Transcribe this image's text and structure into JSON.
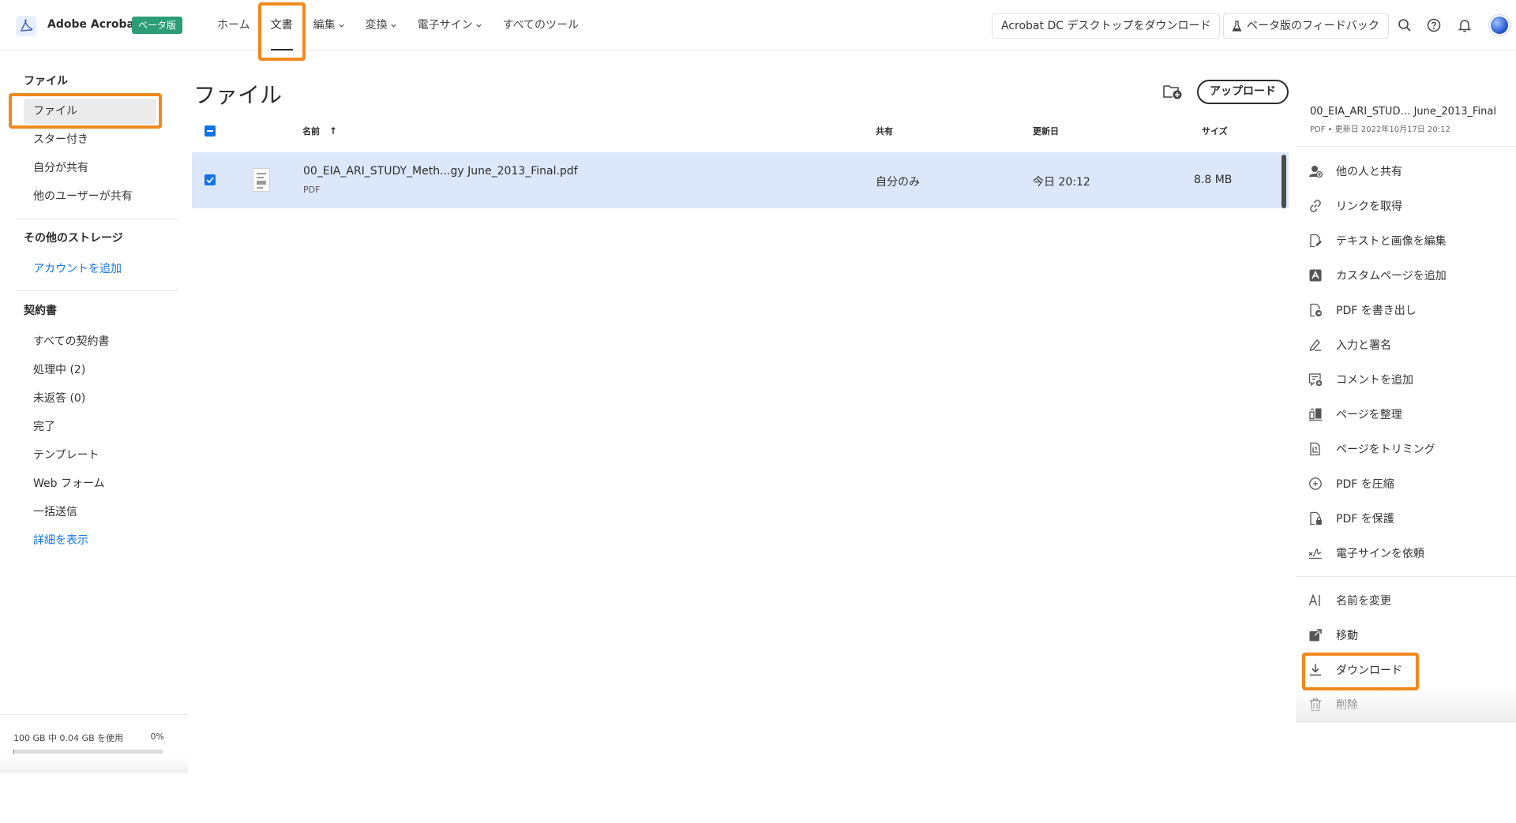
{
  "header": {
    "app_title": "Adobe Acrobat",
    "beta_badge": "ベータ版",
    "nav": {
      "home": "ホーム",
      "documents": "文書",
      "edit": "編集",
      "convert": "変換",
      "esign": "電子サイン",
      "all_tools": "すべてのツール"
    },
    "download_desktop": "Acrobat DC デスクトップをダウンロード",
    "beta_feedback": "ベータ版のフィードバック",
    "icons": [
      "search-icon",
      "help-icon",
      "bell-icon",
      "avatar"
    ]
  },
  "sidebar": {
    "files_heading": "ファイル",
    "files_items": {
      "files": "ファイル",
      "starred": "スター付き",
      "shared_by_me": "自分が共有",
      "shared_by_others": "他のユーザーが共有"
    },
    "other_storage_heading": "その他のストレージ",
    "add_account": "アカウントを追加",
    "agreements_heading": "契約書",
    "agreements_items": {
      "all": "すべての契約書",
      "in_progress": "処理中 (2)",
      "waiting": "未返答 (0)",
      "completed": "完了",
      "templates": "テンプレート",
      "web_forms": "Web フォーム",
      "bulk_send": "一括送信",
      "show_more": "詳細を表示"
    },
    "storage": {
      "text": "100 GB 中 0.04 GB を使用",
      "percent_label": "0%",
      "used_fraction": 0.0004
    }
  },
  "main": {
    "title": "ファイル",
    "upload_label": "アップロード",
    "columns": {
      "name": "名前",
      "sort_arrow": "↑",
      "shared": "共有",
      "modified": "更新日",
      "size": "サイズ"
    },
    "rows": [
      {
        "name": "00_EIA_ARI_STUDY_Meth...gy June_2013_Final.pdf",
        "type": "PDF",
        "shared": "自分のみ",
        "modified": "今日 20:12",
        "size": "8.8 MB",
        "checked": true
      }
    ]
  },
  "right_panel": {
    "title": "00_EIA_ARI_STUD… June_2013_Final",
    "meta": "PDF • 更新日 2022年10月17日 20:12",
    "actions": [
      {
        "label": "他の人と共有",
        "icon": "share-people-icon"
      },
      {
        "label": "リンクを取得",
        "icon": "link-icon"
      },
      {
        "label": "テキストと画像を編集",
        "icon": "edit-pdf-icon"
      },
      {
        "label": "カスタムページを追加",
        "icon": "custom-page-icon"
      },
      {
        "label": "PDF を書き出し",
        "icon": "export-pdf-icon"
      },
      {
        "label": "入力と署名",
        "icon": "fill-sign-icon"
      },
      {
        "label": "コメントを追加",
        "icon": "comment-icon"
      },
      {
        "label": "ページを整理",
        "icon": "organize-pages-icon"
      },
      {
        "label": "ページをトリミング",
        "icon": "crop-icon"
      },
      {
        "label": "PDF を圧縮",
        "icon": "compress-icon"
      },
      {
        "label": "PDF を保護",
        "icon": "protect-icon"
      },
      {
        "label": "電子サインを依頼",
        "icon": "request-sign-icon"
      }
    ],
    "file_actions": [
      {
        "label": "名前を変更",
        "icon": "rename-icon"
      },
      {
        "label": "移動",
        "icon": "move-icon"
      },
      {
        "label": "ダウンロード",
        "icon": "download-icon"
      },
      {
        "label": "削除",
        "icon": "trash-icon"
      }
    ]
  },
  "colors": {
    "accent_blue": "#1473e6",
    "selected_row": "#dce8f9",
    "highlight_orange": "#f0891d",
    "beta_green": "#2d9d78"
  }
}
